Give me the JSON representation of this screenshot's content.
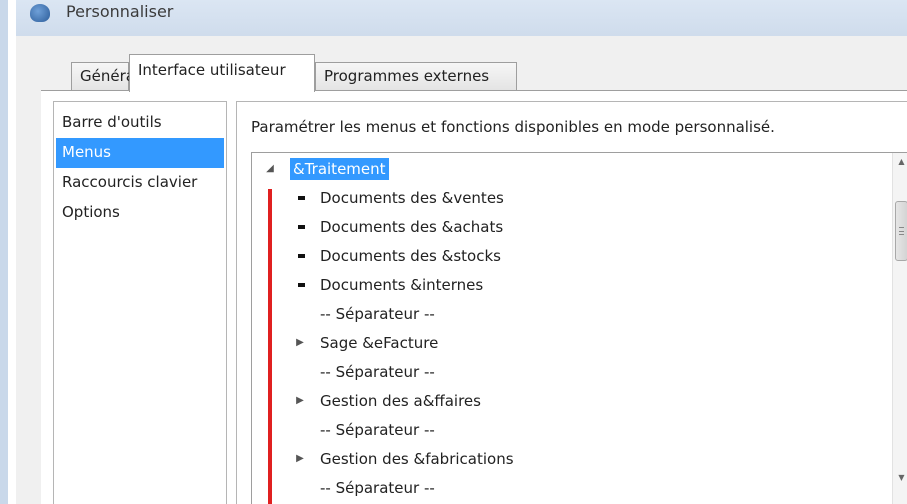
{
  "window": {
    "title": "Personnaliser"
  },
  "tabs": [
    {
      "label": "Général"
    },
    {
      "label": "Interface utilisateur"
    },
    {
      "label": "Programmes externes"
    }
  ],
  "sidebar": {
    "items": [
      {
        "label": "Barre d'outils"
      },
      {
        "label": "Menus"
      },
      {
        "label": "Raccourcis clavier"
      },
      {
        "label": "Options"
      }
    ]
  },
  "main": {
    "description": "Paramétrer les menus et fonctions disponibles en mode personnalisé.",
    "tree": [
      {
        "label": "&Traitement"
      },
      {
        "label": "Documents des &ventes"
      },
      {
        "label": "Documents des &achats"
      },
      {
        "label": "Documents des &stocks"
      },
      {
        "label": "Documents &internes"
      },
      {
        "label": "-- Séparateur --"
      },
      {
        "label": "Sage &eFacture"
      },
      {
        "label": "-- Séparateur --"
      },
      {
        "label": "Gestion des a&ffaires"
      },
      {
        "label": "-- Séparateur --"
      },
      {
        "label": "Gestion des &fabrications"
      },
      {
        "label": "-- Séparateur --"
      }
    ]
  },
  "colors": {
    "selection": "#3399ff",
    "annotation_line": "#e02020"
  }
}
